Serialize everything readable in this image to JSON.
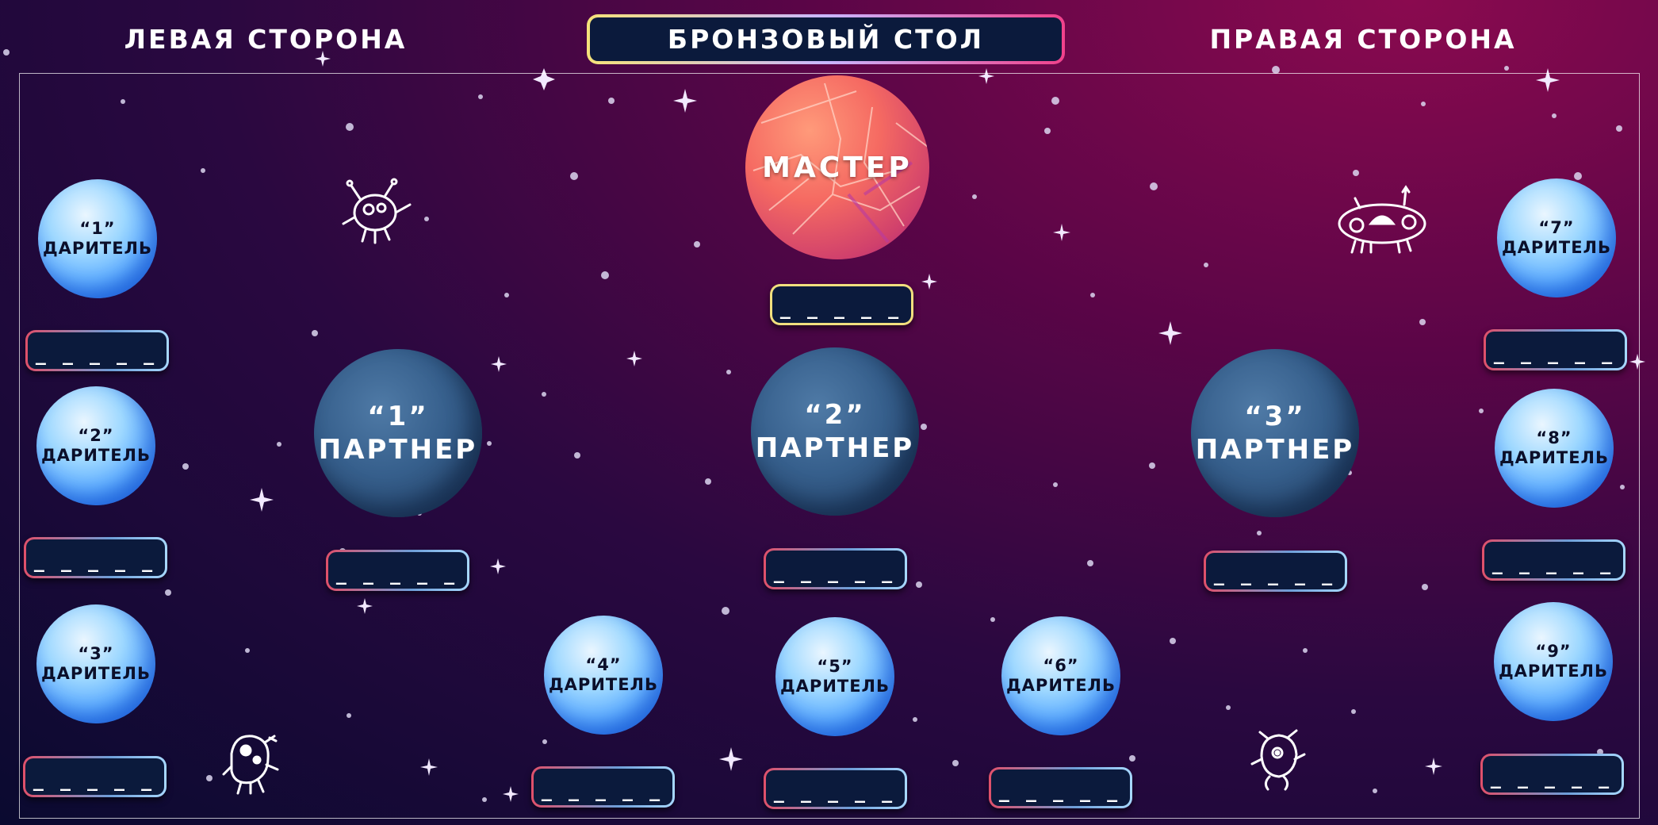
{
  "header": {
    "left_title": "ЛЕВАЯ СТОРОНА",
    "center_title": "БРОНЗОВЫЙ СТОЛ",
    "right_title": "ПРАВАЯ СТОРОНА"
  },
  "master": {
    "label": "МАСТЕР",
    "slot": "_ _ _ _ _"
  },
  "partners": [
    {
      "number": "“1”",
      "label": "ПАРТНЕР",
      "slot": "_ _ _ _ _"
    },
    {
      "number": "“2”",
      "label": "ПАРТНЕР",
      "slot": "_ _ _ _ _"
    },
    {
      "number": "“3”",
      "label": "ПАРТНЕР",
      "slot": "_ _ _ _ _"
    }
  ],
  "givers": [
    {
      "number": "“1”",
      "label": "ДАРИТЕЛЬ",
      "slot": "_ _ _ _ _"
    },
    {
      "number": "“2”",
      "label": "ДАРИТЕЛЬ",
      "slot": "_ _ _ _ _"
    },
    {
      "number": "“3”",
      "label": "ДАРИТЕЛЬ",
      "slot": "_ _ _ _ _"
    },
    {
      "number": "“4”",
      "label": "ДАРИТЕЛЬ",
      "slot": "_ _ _ _ _"
    },
    {
      "number": "“5”",
      "label": "ДАРИТЕЛЬ",
      "slot": "_ _ _ _ _"
    },
    {
      "number": "“6”",
      "label": "ДАРИТЕЛЬ",
      "slot": "_ _ _ _ _"
    },
    {
      "number": "“7”",
      "label": "ДАРИТЕЛЬ",
      "slot": "_ _ _ _ _"
    },
    {
      "number": "“8”",
      "label": "ДАРИТЕЛЬ",
      "slot": "_ _ _ _ _"
    },
    {
      "number": "“9”",
      "label": "ДАРИТЕЛЬ",
      "slot": "_ _ _ _ _"
    }
  ],
  "decorations": [
    "alien-critter-icon",
    "ufo-critter-icon",
    "monster-critter-icon",
    "robot-critter-icon"
  ]
}
